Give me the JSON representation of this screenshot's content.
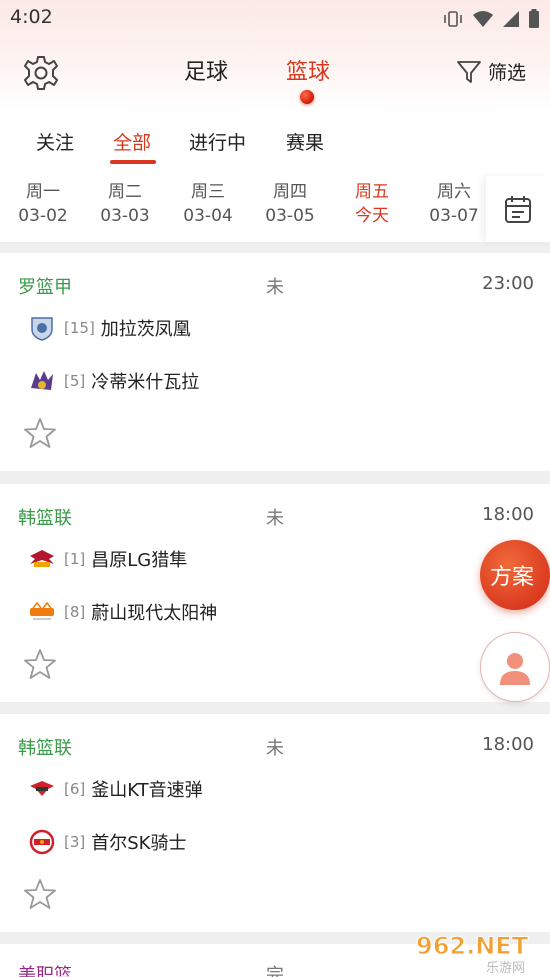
{
  "status_bar": {
    "time": "4:02"
  },
  "header": {
    "sport_tabs": [
      {
        "label": "足球",
        "active": false
      },
      {
        "label": "篮球",
        "active": true
      }
    ],
    "filter_label": "筛选"
  },
  "sub_tabs": [
    {
      "label": "关注",
      "active": false
    },
    {
      "label": "全部",
      "active": true
    },
    {
      "label": "进行中",
      "active": false
    },
    {
      "label": "赛果",
      "active": false
    }
  ],
  "days": [
    {
      "weekday": "周一",
      "date": "03-02",
      "active": false
    },
    {
      "weekday": "周二",
      "date": "03-03",
      "active": false
    },
    {
      "weekday": "周三",
      "date": "03-04",
      "active": false
    },
    {
      "weekday": "周四",
      "date": "03-05",
      "active": false
    },
    {
      "weekday": "周五",
      "date": "今天",
      "active": true
    },
    {
      "weekday": "周六",
      "date": "03-07",
      "active": false
    }
  ],
  "matches": [
    {
      "league": "罗篮甲",
      "league_color": "#3a9a4a",
      "status": "未",
      "time": "23:00",
      "home": {
        "rank": "[15]",
        "name": "加拉茨凤凰"
      },
      "away": {
        "rank": "[5]",
        "name": "冷蒂米什瓦拉"
      }
    },
    {
      "league": "韩篮联",
      "league_color": "#3a9a4a",
      "status": "未",
      "time": "18:00",
      "home": {
        "rank": "[1]",
        "name": "昌原LG猎隼"
      },
      "away": {
        "rank": "[8]",
        "name": "蔚山现代太阳神"
      }
    },
    {
      "league": "韩篮联",
      "league_color": "#3a9a4a",
      "status": "未",
      "time": "18:00",
      "home": {
        "rank": "[6]",
        "name": "釜山KT音速弹"
      },
      "away": {
        "rank": "[3]",
        "name": "首尔SK骑士"
      }
    },
    {
      "league": "美职篮",
      "league_color": "#9a2a8a",
      "status": "完",
      "time": ""
    }
  ],
  "fab": {
    "plan_label": "方案"
  },
  "watermark": {
    "text": "962.NET",
    "sub": "乐游网"
  },
  "colors": {
    "accent": "#d9381e",
    "league_green": "#3a9a4a"
  }
}
